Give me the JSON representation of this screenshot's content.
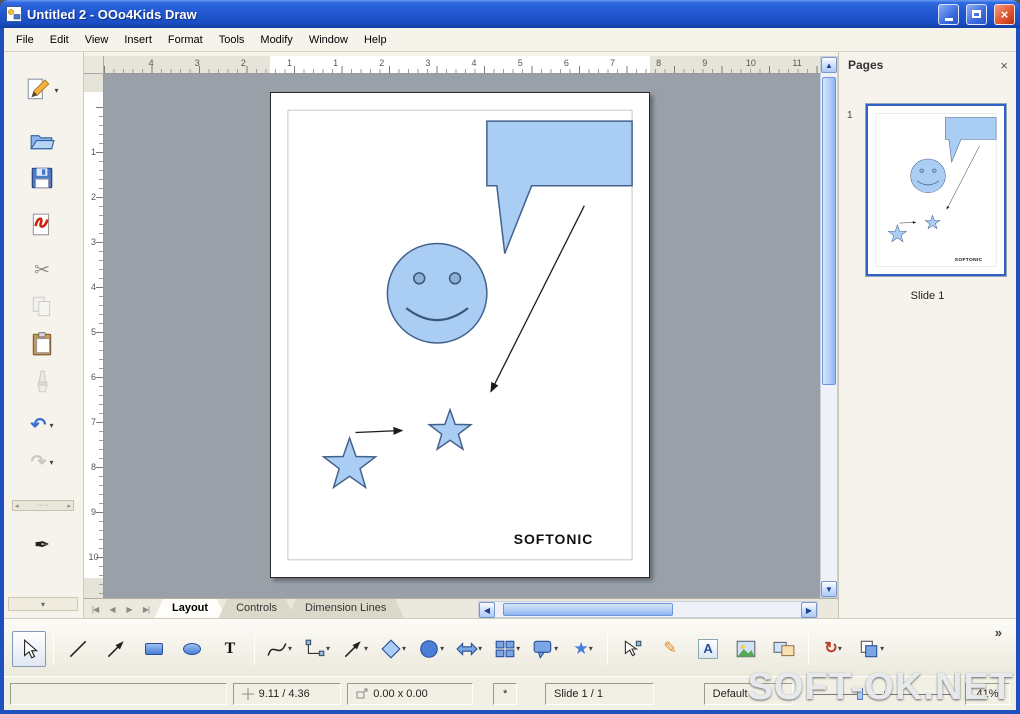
{
  "colors": {
    "titlebar_blue": "#2157d0",
    "window_border": "#1e50c0",
    "toolbar_bg": "#f5f3ec",
    "canvas_bg": "#99a0a8",
    "shape_fill": "#a9cdf3",
    "shape_stroke": "#44618c",
    "scrollbar_thumb": "#a9c6f5",
    "thumbnail_border": "#2f62c4"
  },
  "window": {
    "title": "Untitled 2 - OOo4Kids Draw"
  },
  "menubar": {
    "items": [
      "File",
      "Edit",
      "View",
      "Insert",
      "Format",
      "Tools",
      "Modify",
      "Window",
      "Help"
    ]
  },
  "left_toolbar": {
    "items": [
      "new-drawing",
      "open",
      "save",
      "export-pdf",
      "cut",
      "copy",
      "paste",
      "format-paintbrush",
      "undo",
      "redo",
      "pen"
    ]
  },
  "rulers": {
    "horizontal": [
      "4",
      "3",
      "2",
      "1",
      "1",
      "2",
      "3",
      "4",
      "5",
      "6",
      "7",
      "8",
      "9",
      "10",
      "11"
    ],
    "vertical": [
      "1",
      "2",
      "3",
      "4",
      "5",
      "6",
      "7",
      "8",
      "9",
      "10"
    ]
  },
  "canvas": {
    "page_text": "SOFTONIC"
  },
  "tabs": {
    "items": [
      "Layout",
      "Controls",
      "Dimension Lines"
    ],
    "active": "Layout"
  },
  "pages_panel": {
    "title": "Pages",
    "page_number": "1",
    "slide_label": "Slide 1"
  },
  "bottom_toolbar": {
    "items": [
      "select",
      "line",
      "arrow",
      "rectangle",
      "ellipse",
      "text",
      "curve",
      "connector",
      "lines-arrows",
      "basic-shapes",
      "symbol-shapes",
      "block-arrows",
      "flowchart",
      "callouts",
      "stars",
      "points",
      "glue-points",
      "fontwork",
      "from-file",
      "gallery",
      "rotate",
      "arrange"
    ]
  },
  "status_bar": {
    "position": "9.11 / 4.36",
    "object_size": "0.00 x 0.00",
    "modified": "*",
    "slide": "Slide 1 / 1",
    "style": "Default",
    "zoom": "41%"
  },
  "watermark": "SOFT-OK.NET",
  "icons": {
    "dropdown": "▾",
    "scroll_up": "▲",
    "scroll_down": "▼",
    "scroll_left": "◀",
    "scroll_right": "▶",
    "tab_first": "|◀",
    "tab_prev": "◀",
    "tab_next": "▶",
    "tab_last": "▶|",
    "cut": "✂",
    "undo": "↶",
    "redo": "↷",
    "pen": "✒",
    "glue_pen": "✎",
    "star": "★",
    "rotate": "↻",
    "text_tool": "T",
    "fontwork": "A",
    "overflow": "»",
    "overflow_down": "▾",
    "panel_close": "×",
    "close": "×",
    "splitter_left": "◂",
    "splitter_right": "▸",
    "splitter_dots": "·····"
  }
}
